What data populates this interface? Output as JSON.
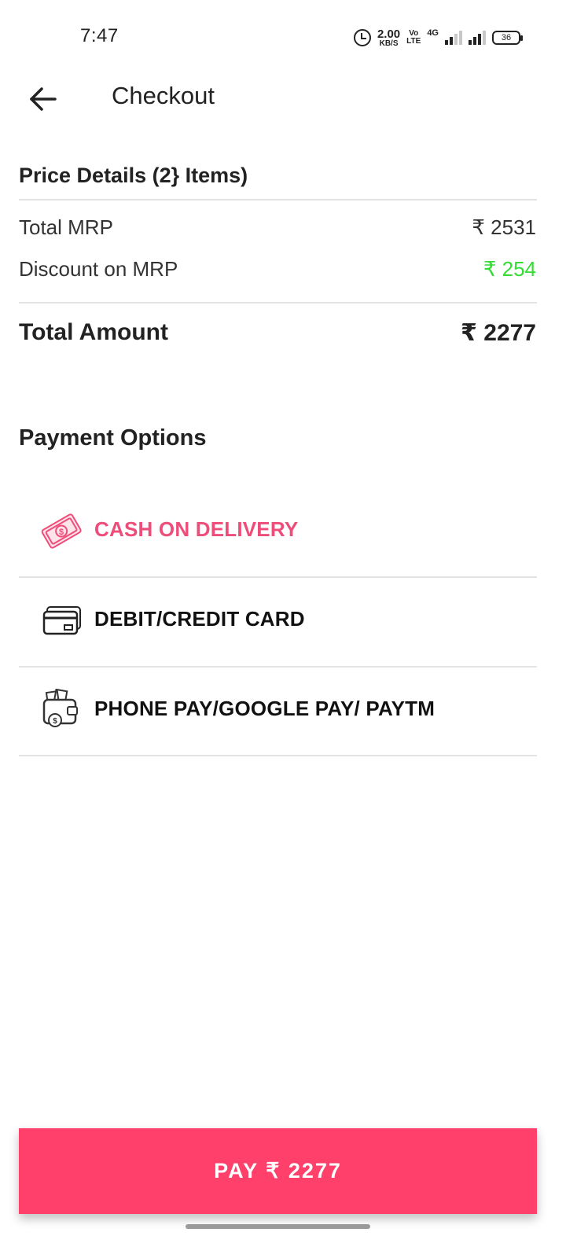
{
  "status_bar": {
    "time": "7:47",
    "net_speed_value": "2.00",
    "net_speed_unit": "KB/S",
    "volte_top": "Vo",
    "volte_bottom": "LTE",
    "network_type": "4G",
    "battery_level": "36"
  },
  "header": {
    "title": "Checkout",
    "back_icon": "arrow-left-icon"
  },
  "price_details": {
    "title": "Price Details (2} Items)",
    "total_mrp_label": "Total MRP",
    "total_mrp_value": "₹ 2531",
    "discount_label": "Discount on MRP",
    "discount_value": "₹ 254",
    "discount_color": "#33dd33",
    "total_amount_label": "Total Amount",
    "total_amount_value": "₹ 2277"
  },
  "payment_options": {
    "title": "Payment Options",
    "options": [
      {
        "label": "CASH ON DELIVERY",
        "icon": "cash-icon",
        "selected": true
      },
      {
        "label": "DEBIT/CREDIT CARD",
        "icon": "credit-card-icon",
        "selected": false
      },
      {
        "label": "PHONE PAY/GOOGLE PAY/ PAYTM",
        "icon": "wallet-icon",
        "selected": false
      }
    ],
    "selected_color": "#ee4d7a"
  },
  "pay_button": {
    "label": "PAY ₹ 2277",
    "color": "#fe406b"
  }
}
